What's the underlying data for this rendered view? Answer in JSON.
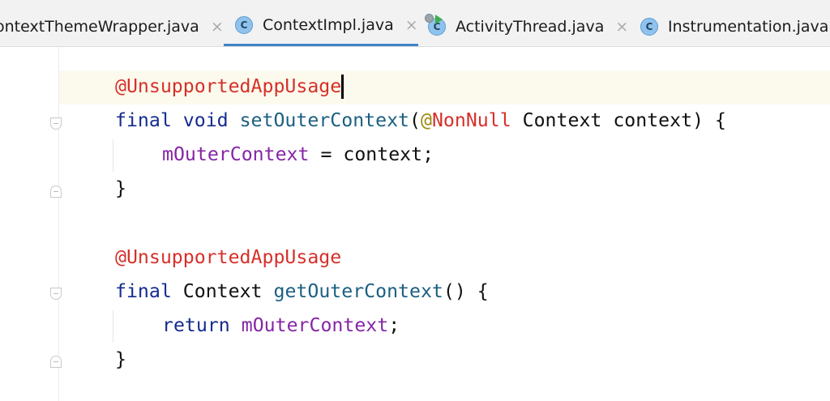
{
  "tabs": [
    {
      "label": "ontextThemeWrapper.java",
      "close": "×",
      "icon": "none",
      "active": false
    },
    {
      "label": "ContextImpl.java",
      "close": "×",
      "icon": "class-icon",
      "icon_letter": "C",
      "active": true
    },
    {
      "label": "ActivityThread.java",
      "close": "×",
      "icon": "runnable-class-icon",
      "icon_letter": "C",
      "active": false
    },
    {
      "label": "Instrumentation.java",
      "icon": "class-icon",
      "icon_letter": "C",
      "active": false
    }
  ],
  "colors": {
    "annotation": "#d6302a",
    "keyword": "#152c8f",
    "method": "#1c6082",
    "field": "#8526a6",
    "nonnull": "#9e880c",
    "active_tab_underline": "#4083c9",
    "caret_line": "#fcfaed"
  },
  "code": {
    "line1": {
      "annotation": "@UnsupportedAppUsage"
    },
    "line2": {
      "kw_final": "final",
      "kw_void": "void",
      "method": "setOuterContext",
      "paren_open": "(",
      "nonnull_at": "@",
      "nonnull_name": "NonNull",
      "param_type": "Context",
      "param_name": "context",
      "paren_close_brace": ") {"
    },
    "line3": {
      "field": "mOuterContext",
      "assign": " = context;"
    },
    "line4": {
      "brace": "}"
    },
    "line5": {
      "annotation": "@UnsupportedAppUsage"
    },
    "line6": {
      "kw_final": "final",
      "return_type": "Context",
      "method": "getOuterContext",
      "rest": "() {"
    },
    "line7": {
      "kw_return": "return",
      "field": "mOuterContext",
      "semicolon": ";"
    },
    "line8": {
      "brace": "}"
    }
  }
}
